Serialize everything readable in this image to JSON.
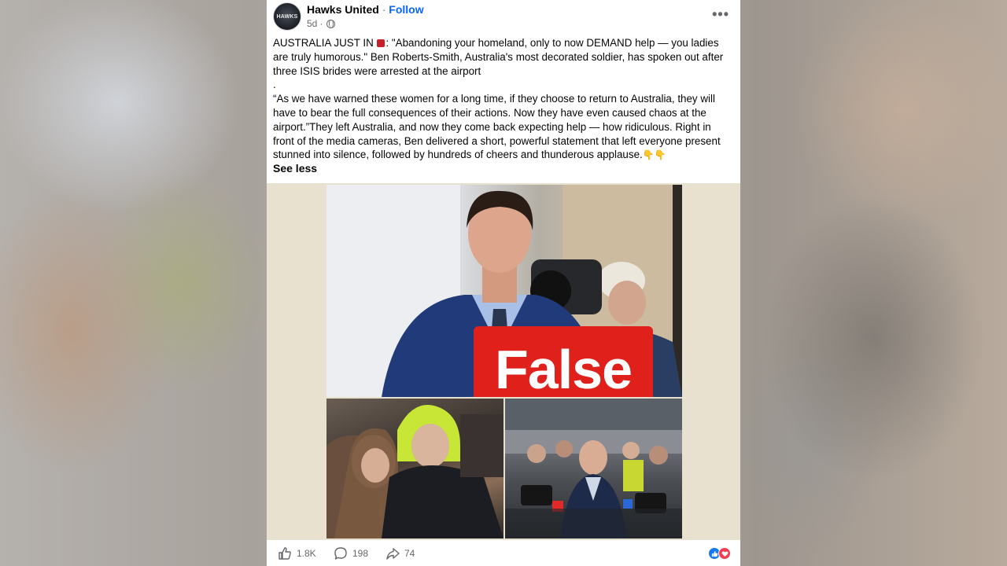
{
  "post": {
    "page_name": "Hawks United",
    "separator": "·",
    "follow_label": "Follow",
    "age": "5d",
    "avatar_text": "HAWKS",
    "paragraph_1": "AUSTRALIA JUST IN ",
    "paragraph_1b": ": \"Abandoning your homeland, only to now DEMAND help — you ladies are truly humorous.\" Ben Roberts-Smith, Australia's most decorated soldier, has spoken out after three ISIS brides were arrested at the airport",
    "dot_line": ".",
    "paragraph_2": "“As we have warned these women for a long time, if they choose to return to Australia, they will have to bear the full consequences of their actions. Now they have even caused chaos at the airport.”They left Australia, and now they come back expecting help — how ridiculous. Right in front of the media cameras, Ben delivered a short, powerful statement that left everyone present stunned into silence, followed by hundreds of cheers and thunderous applause.",
    "see_less": "See less",
    "overlay_label": "False"
  },
  "stats": {
    "likes": "1.8K",
    "comments": "198",
    "shares": "74"
  },
  "icons": {
    "more": "more-options-icon",
    "privacy": "globe-icon",
    "like": "thumbs-up-icon",
    "comment": "comment-bubble-icon",
    "share": "share-arrow-icon",
    "flag": "flag-emoji-icon",
    "pointing": "pointing-down-emoji-icon"
  },
  "colors": {
    "follow": "#0866ff",
    "false_label": "#e0201a",
    "like_reaction": "#1877f2",
    "love_reaction": "#f33e58"
  }
}
